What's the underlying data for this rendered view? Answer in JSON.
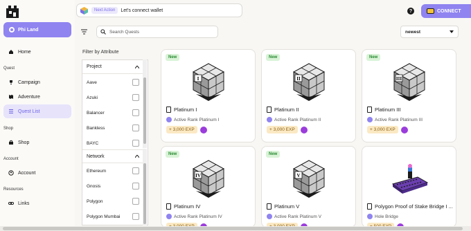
{
  "app": {
    "name": "Phi Land"
  },
  "sidebar": {
    "home": "Home",
    "section_quest": "Quest",
    "campaign": "Campaign",
    "adventure": "Adventure",
    "quest_list": "Quest List",
    "section_shop": "Shop",
    "shop": "Shop",
    "section_account": "Account",
    "account": "Account",
    "section_resources": "Resources",
    "links": "Links"
  },
  "topbar": {
    "next_action_badge": "Next Action",
    "next_action_text": "Let's connect wallet",
    "help": "?",
    "connect_label": "CONNECT"
  },
  "toolbar": {
    "search_placeholder": "Search Quests",
    "sort_value": "newest"
  },
  "filter": {
    "title": "Filter by Attribute",
    "groups": [
      {
        "label": "Project",
        "items": [
          "Aave",
          "Azuki",
          "Balancer",
          "Bankless",
          "BAYC"
        ]
      },
      {
        "label": "Network",
        "items": [
          "Ethereum",
          "Gnosis",
          "Polygon",
          "Polygon Mumbai"
        ]
      }
    ]
  },
  "quests": [
    {
      "badge": "New",
      "title": "Platinum I",
      "subtitle": "Active Rank Platinum I",
      "exp": "+ 3,000 EXP",
      "numeral": "I"
    },
    {
      "badge": "New",
      "title": "Platinum II",
      "subtitle": "Active Rank Platinum II",
      "exp": "+ 3,000 EXP",
      "numeral": "II"
    },
    {
      "badge": "New",
      "title": "Platinum III",
      "subtitle": "Active Rank Platinum III",
      "exp": "+ 3,000 EXP",
      "numeral": "III"
    },
    {
      "badge": "New",
      "title": "Platinum IV",
      "subtitle": "Active Rank Platinum IV",
      "exp": "+ 3,000 EXP",
      "numeral": "IV"
    },
    {
      "badge": "New",
      "title": "Platinum V",
      "subtitle": "Active Rank Platinum V",
      "exp": "+ 3,000 EXP",
      "numeral": "V"
    },
    {
      "badge": "",
      "title": "Polygon Proof of Stake Bridge I ...",
      "subtitle": "Hole Bridge",
      "exp": "+ 500 EXP",
      "numeral": ""
    }
  ],
  "colors": {
    "accent": "#8f84f0",
    "new_badge_bg": "#d9f3d7",
    "exp_bg": "#fbe9c4"
  }
}
